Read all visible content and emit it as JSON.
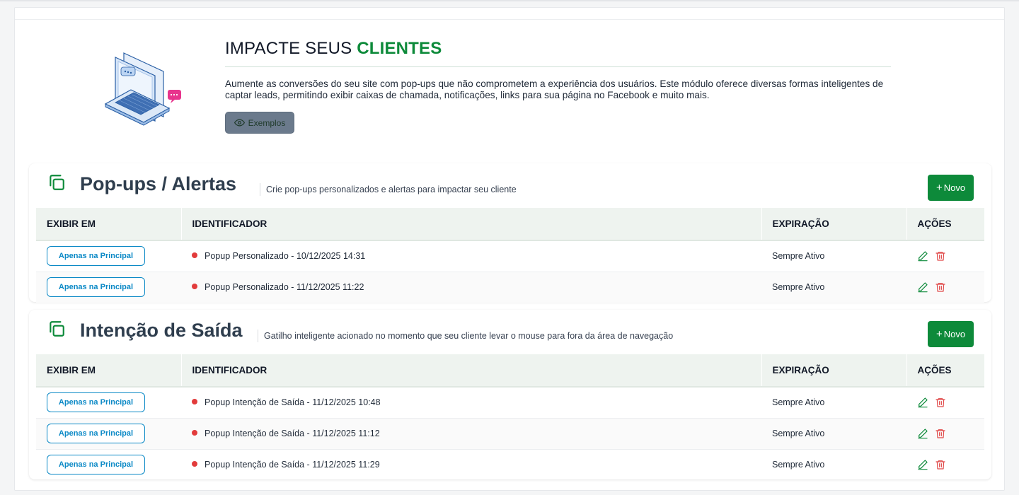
{
  "hero": {
    "title_prefix": "IMPACTE SEUS ",
    "title_accent": "CLIENTES",
    "description": "Aumente as conversões do seu site com pop-ups que não comprometem a experiência dos usuários. Este módulo oferece diversas formas inteligentes de captar leads, permitindo exibir caixas de chamada, notificações, links para sua página no Facebook e muito mais.",
    "examples_label": "Exemplos"
  },
  "colors": {
    "accent_green": "#0d8a3a",
    "badge_blue": "#0b89c6",
    "status_red": "#e23b3b",
    "delete_red": "#e04848"
  },
  "sections": [
    {
      "title": "Pop-ups / Alertas",
      "subtitle": "Crie pop-ups personalizados e alertas para impactar seu cliente",
      "new_label": "Novo",
      "columns": [
        "EXIBIR EM",
        "IDENTIFICADOR",
        "EXPIRAÇÃO",
        "AÇÕES"
      ],
      "rows": [
        {
          "display": "Apenas na Principal",
          "identifier": "Popup Personalizado - 10/12/2025 14:31",
          "expiration": "Sempre Ativo"
        },
        {
          "display": "Apenas na Principal",
          "identifier": "Popup Personalizado - 11/12/2025 11:22",
          "expiration": "Sempre Ativo"
        }
      ]
    },
    {
      "title": "Intenção de Saída",
      "subtitle": "Gatilho inteligente acionado no momento que seu cliente levar o mouse para fora da área de navegação",
      "new_label": "Novo",
      "columns": [
        "EXIBIR EM",
        "IDENTIFICADOR",
        "EXPIRAÇÃO",
        "AÇÕES"
      ],
      "rows": [
        {
          "display": "Apenas na Principal",
          "identifier": "Popup Intenção de Saída - 11/12/2025 10:48",
          "expiration": "Sempre Ativo"
        },
        {
          "display": "Apenas na Principal",
          "identifier": "Popup Intenção de Saída - 11/12/2025 11:12",
          "expiration": "Sempre Ativo"
        },
        {
          "display": "Apenas na Principal",
          "identifier": "Popup Intenção de Saída - 11/12/2025 11:29",
          "expiration": "Sempre Ativo"
        }
      ]
    }
  ]
}
